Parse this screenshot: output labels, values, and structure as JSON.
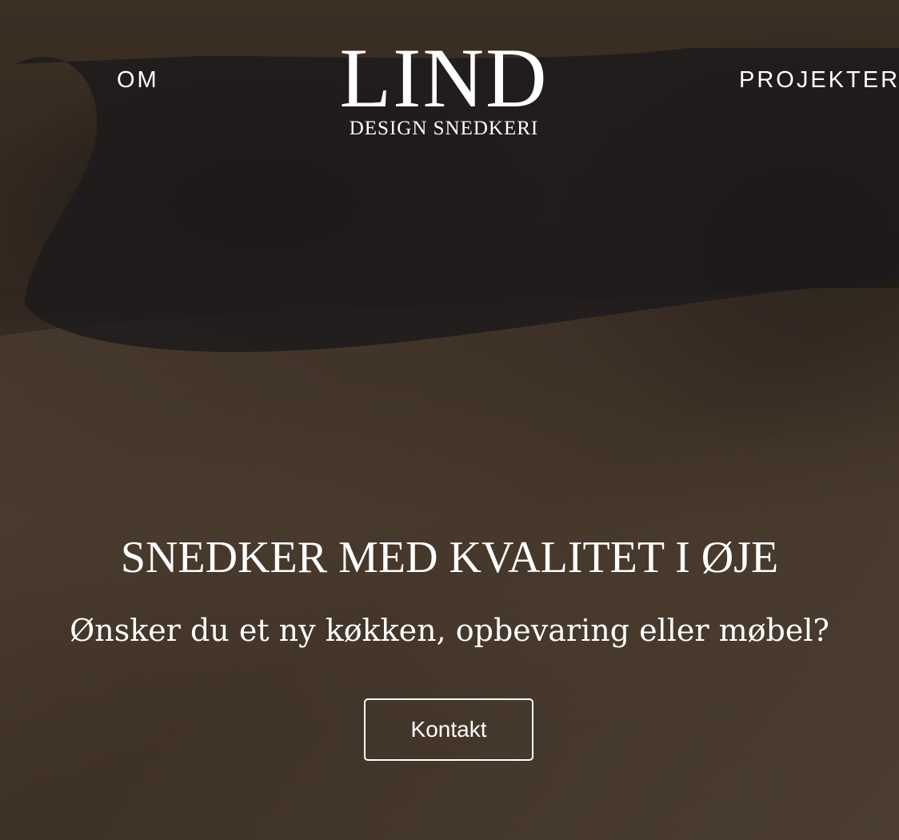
{
  "nav": {
    "left_link": "OM",
    "right_link": "PROJEKTER"
  },
  "logo": {
    "main": "LIND",
    "sub": "DESIGN SNEDKERI"
  },
  "hero": {
    "headline": "SNEDKER MED KVALITET I ØJE",
    "subline": "Ønsker du et ny køkken, opbevaring eller møbel?",
    "cta_label": "Kontakt"
  },
  "colors": {
    "text": "#ffffff",
    "background_dark": "#3a2f27",
    "background_wood": "#5a4838"
  }
}
